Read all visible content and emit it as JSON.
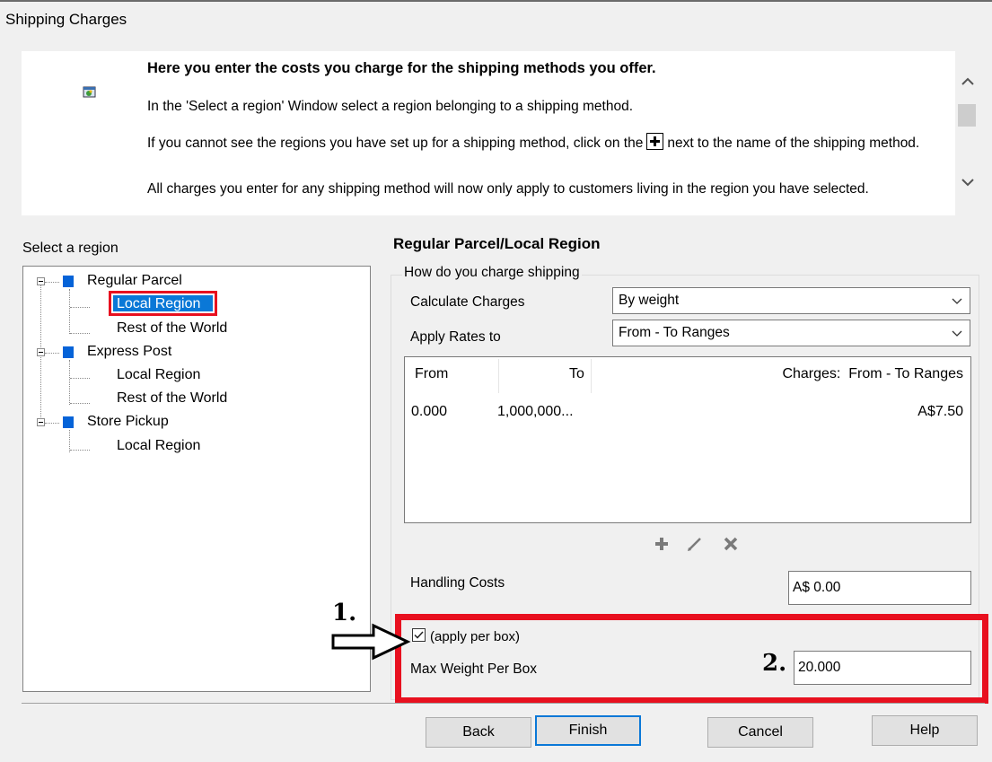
{
  "window": {
    "title": "Shipping Charges"
  },
  "info": {
    "heading": "Here you enter the costs you charge for the shipping methods you offer.",
    "line1": "In the 'Select a region' Window select a region belonging to a shipping method.",
    "line2_before": "If you cannot see the regions you have set up for a shipping method, click on the",
    "line2_after": "next to the name of the shipping method.",
    "line3": "All charges you enter for any shipping method will now only apply to customers living in the region you have selected."
  },
  "tree": {
    "label": "Select a region",
    "methods": [
      {
        "name": "Regular Parcel",
        "regions": [
          "Local Region",
          "Rest of the World"
        ]
      },
      {
        "name": "Express Post",
        "regions": [
          "Local Region",
          "Rest of the World"
        ]
      },
      {
        "name": "Store Pickup",
        "regions": [
          "Local Region"
        ]
      }
    ],
    "selected": "Local Region"
  },
  "detail": {
    "title": "Regular Parcel/Local Region",
    "group_label": "How do you charge shipping",
    "calc_label": "Calculate Charges",
    "calc_value": "By weight",
    "apply_label": "Apply Rates to",
    "apply_value": "From - To Ranges",
    "table": {
      "headers": [
        "From",
        "To",
        "Charges:  From - To Ranges"
      ],
      "rows": [
        {
          "from": "0.000",
          "to": "1,000,000...",
          "charge": "A$7.50"
        }
      ]
    },
    "handling_label": "Handling Costs",
    "handling_value": "A$ 0.00",
    "apply_per_box_label": "(apply per box)",
    "apply_per_box_checked": true,
    "max_weight_label": "Max Weight Per Box",
    "max_weight_value": "20.000"
  },
  "annotations": {
    "one": "1.",
    "two": "2."
  },
  "buttons": {
    "back": "Back",
    "finish": "Finish",
    "cancel": "Cancel",
    "help": "Help"
  },
  "colors": {
    "highlight_red": "#e8101f",
    "selection_blue": "#0a78d7",
    "node_blue": "#0563d8"
  }
}
